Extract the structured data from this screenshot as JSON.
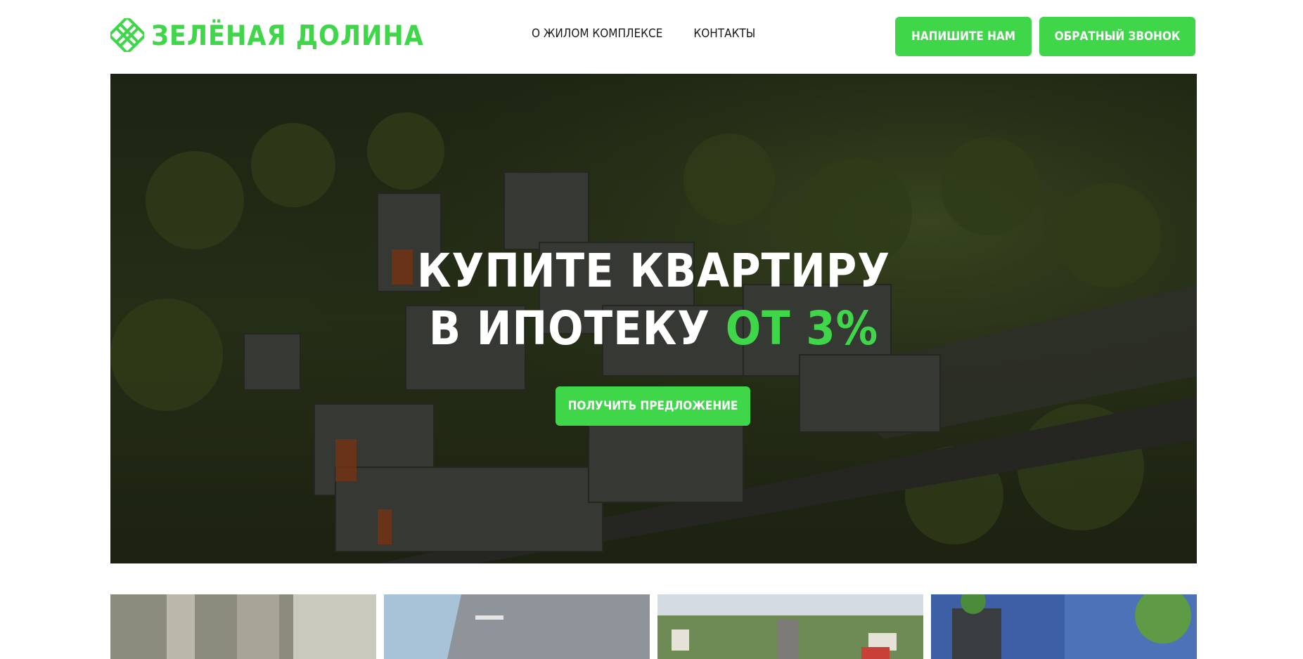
{
  "header": {
    "logo_text": "ЗЕЛЁНАЯ ДОЛИНА",
    "logo_icon": "leaf-knot-logo-icon",
    "nav": [
      {
        "label": "О ЖИЛОМ КОМПЛЕКСЕ"
      },
      {
        "label": "КОНТАКТЫ"
      }
    ],
    "write_label": "НАПИШИТЕ НАМ",
    "call_label": "ОБРАТНЫЙ ЗВОНОК"
  },
  "hero": {
    "title_line1": "КУПИТЕ КВАРТИРУ",
    "title_line2_prefix": "В ИПОТЕКУ",
    "title_line2_accent": "ОТ 3%",
    "cta_label": "ПОЛУЧИТЬ ПРЕДЛОЖЕНИЕ",
    "image": "aerial-residential-complex-photo"
  },
  "gallery": {
    "items": [
      {
        "image": "interior-photo"
      },
      {
        "image": "building-facade-photo"
      },
      {
        "image": "city-aerial-photo"
      },
      {
        "image": "building-render-photo"
      }
    ]
  },
  "colors": {
    "accent": "#3fd64a",
    "text": "#1a1a1a",
    "hero_overlay": "#0a0c08"
  }
}
